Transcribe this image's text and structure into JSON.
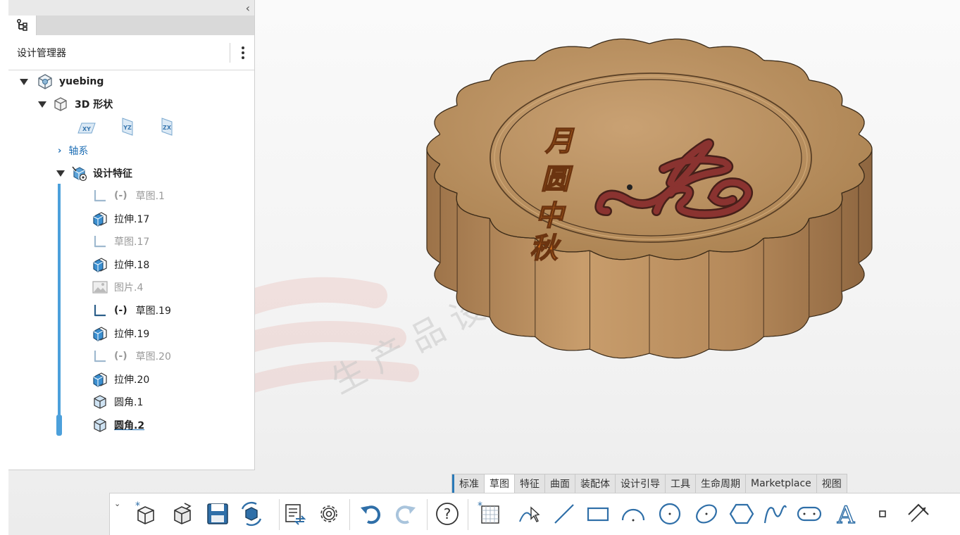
{
  "panel": {
    "collapse_glyph": "‹",
    "title": "设计管理器",
    "tree": {
      "root": "yuebing",
      "shape": "3D 形状",
      "planes": [
        "XY",
        "YZ",
        "ZX"
      ],
      "axes": "轴系",
      "features": "设计特征",
      "items": [
        {
          "paren": "(-)",
          "label": "草图.1",
          "icon": "sketch-icon",
          "dim": true
        },
        {
          "paren": "",
          "label": "拉伸.17",
          "icon": "extrude-icon",
          "dim": false
        },
        {
          "paren": "",
          "label": "草图.17",
          "icon": "sketch-icon",
          "dim": true
        },
        {
          "paren": "",
          "label": "拉伸.18",
          "icon": "extrude-icon",
          "dim": false
        },
        {
          "paren": "",
          "label": "图片.4",
          "icon": "image-icon",
          "dim": true
        },
        {
          "paren": "(-)",
          "label": "草图.19",
          "icon": "sketch-icon",
          "dim": false
        },
        {
          "paren": "",
          "label": "拉伸.19",
          "icon": "extrude-icon",
          "dim": false
        },
        {
          "paren": "(-)",
          "label": "草图.20",
          "icon": "sketch-icon",
          "dim": true
        },
        {
          "paren": "",
          "label": "拉伸.20",
          "icon": "extrude-icon",
          "dim": false
        },
        {
          "paren": "",
          "label": "圆角.1",
          "icon": "fillet-icon",
          "dim": false
        },
        {
          "paren": "",
          "label": "圆角.2",
          "icon": "fillet-icon",
          "dim": false
        }
      ]
    }
  },
  "viewport": {
    "emboss_text": [
      "月",
      "圆",
      "中",
      "秋"
    ],
    "watermark": "生 产 品 设 计 研 究"
  },
  "tabs": [
    "标准",
    "草图",
    "特征",
    "曲面",
    "装配体",
    "设计引导",
    "工具",
    "生命周期",
    "Marketplace",
    "视图"
  ],
  "active_tab": "草图",
  "toolbar": {
    "icons": [
      "new-part-icon",
      "open-icon",
      "save-icon",
      "regenerate-icon",
      "properties-icon",
      "settings-icon",
      "undo-icon",
      "redo-icon",
      "help-icon",
      "sketch-grid-icon",
      "smart-sketch-icon",
      "line-icon",
      "rectangle-icon",
      "arc-icon",
      "circle-icon",
      "ellipse-icon",
      "polygon-icon",
      "spline-icon",
      "slot-icon",
      "text-icon",
      "point-icon",
      "dimension-icon"
    ]
  },
  "colors": {
    "accent": "#2a7ab8",
    "tree_line": "#4ca0db",
    "mooncake": "#b88a5a",
    "embossed_text": "#e07a22",
    "rabbit": "#7a2e2a"
  }
}
